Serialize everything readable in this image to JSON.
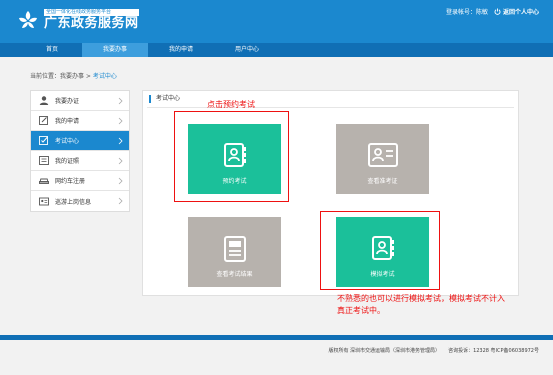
{
  "header": {
    "platform_small": "全国一体化在线政务服务平台",
    "platform_name": "广东政务服务网",
    "account_text": "登录帐号：陈敏",
    "personal_center": "返回个人中心"
  },
  "nav": {
    "items": [
      {
        "label": "首页"
      },
      {
        "label": "我要办事"
      },
      {
        "label": "我的申请"
      },
      {
        "label": "用户中心"
      }
    ],
    "active_index": 1
  },
  "breadcrumb": {
    "prefix": "当前位置：我要办事 > ",
    "current": "考试中心"
  },
  "sidebar": {
    "items": [
      {
        "label": "我要办证",
        "icon": "person-icon"
      },
      {
        "label": "我的申请",
        "icon": "edit-icon"
      },
      {
        "label": "考试中心",
        "icon": "exam-icon"
      },
      {
        "label": "我的证照",
        "icon": "license-icon"
      },
      {
        "label": "网约车注册",
        "icon": "car-icon"
      },
      {
        "label": "巡游上岗信息",
        "icon": "id-card-icon"
      }
    ],
    "active_index": 2
  },
  "main": {
    "title": "考试中心",
    "tiles": [
      {
        "label": "预约考试",
        "color": "#1bc09a",
        "icon": "contact-book-icon"
      },
      {
        "label": "查看准考证",
        "color": "#b7b2ad",
        "icon": "admission-card-icon"
      },
      {
        "label": "查看考试结果",
        "color": "#b7b2ad",
        "icon": "result-document-icon"
      },
      {
        "label": "模拟考试",
        "color": "#1bc09a",
        "icon": "contact-book-icon"
      }
    ]
  },
  "annotations": {
    "top": "点击预约考试",
    "bottom_line1": "不熟悉的也可以进行模拟考试，模拟考试不计入",
    "bottom_line2": "真正考试中。"
  },
  "footer": {
    "copyright": "版权所有 深圳市交通运输局（深圳市港务管理局）",
    "hotline": "咨询投诉：12328 粤ICP备06038972号"
  },
  "colors": {
    "brand_blue": "#1b88cf",
    "nav_blue": "#106fb5",
    "teal": "#1bc09a",
    "gray_tile": "#b7b2ad",
    "annotation_red": "#ee1111"
  }
}
